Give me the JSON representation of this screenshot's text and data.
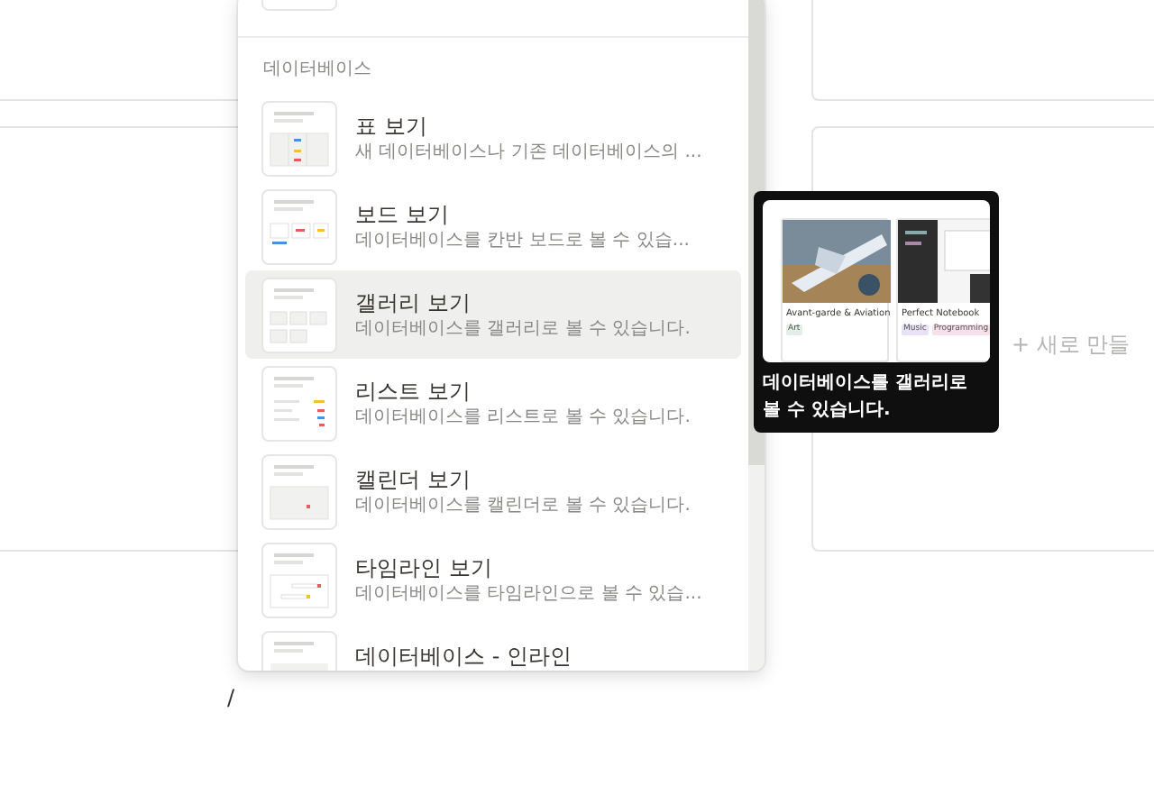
{
  "menu": {
    "section_label": "데이터베이스",
    "items": [
      {
        "kind": "table",
        "title": "표 보기",
        "description": "새 데이터베이스나 기존 데이터베이스의 ...",
        "selected": false
      },
      {
        "kind": "board",
        "title": "보드 보기",
        "description": "데이터베이스를 칸반 보드로 볼 수 있습...",
        "selected": false
      },
      {
        "kind": "gallery",
        "title": "갤러리 보기",
        "description": "데이터베이스를 갤러리로 볼 수 있습니다.",
        "selected": true
      },
      {
        "kind": "list",
        "title": "리스트 보기",
        "description": "데이터베이스를 리스트로 볼 수 있습니다.",
        "selected": false
      },
      {
        "kind": "calendar",
        "title": "캘린더 보기",
        "description": "데이터베이스를 캘린더로 볼 수 있습니다.",
        "selected": false
      },
      {
        "kind": "timeline",
        "title": "타임라인 보기",
        "description": "데이터베이스를 타임라인으로 볼 수 있습...",
        "selected": false
      },
      {
        "kind": "inline",
        "title": "데이터베이스 - 인라인",
        "selected": false
      }
    ]
  },
  "tooltip": {
    "cards": [
      {
        "title": "Avant-garde & Aviation",
        "tags": [
          {
            "label": "Art",
            "color": "#e3efe6"
          }
        ]
      },
      {
        "title": "Perfect Notebook",
        "tags": [
          {
            "label": "Music",
            "color": "#e8e2f6"
          },
          {
            "label": "Programming",
            "color": "#f6e0ea"
          }
        ]
      }
    ],
    "text": "데이터베이스를 갤러리로 볼 수 있습니다."
  },
  "new_button": "+ 새로 만들",
  "cursor_text": "/"
}
